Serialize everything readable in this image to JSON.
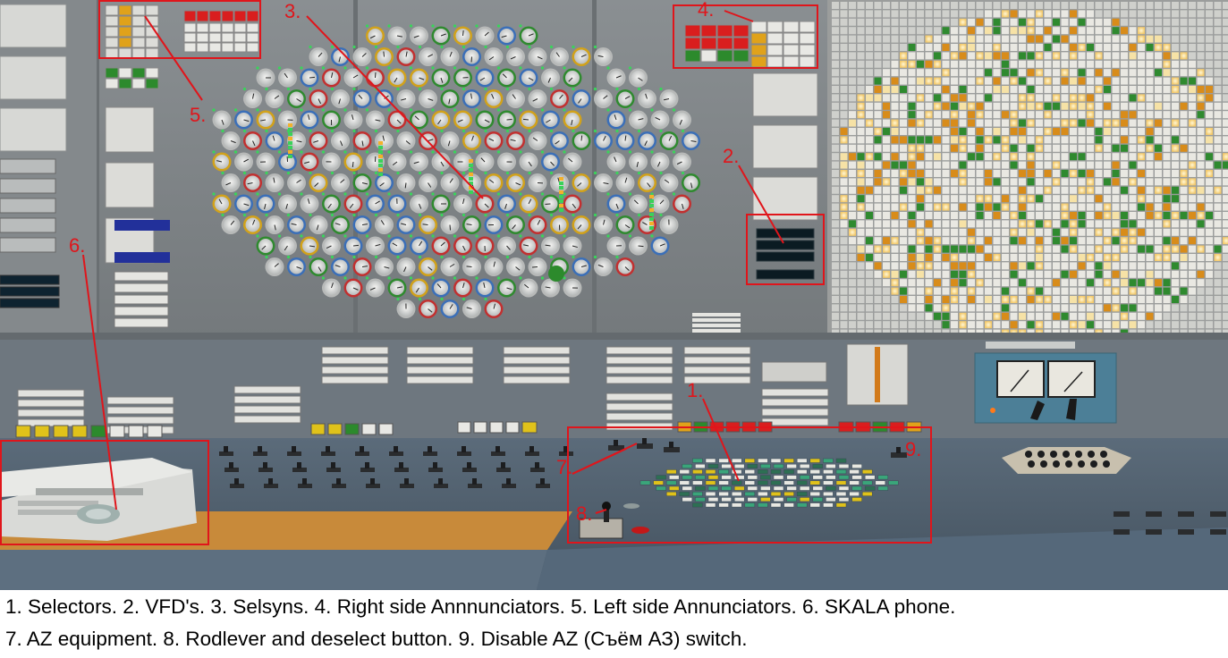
{
  "callouts": [
    {
      "number": "1."
    },
    {
      "number": "2."
    },
    {
      "number": "3."
    },
    {
      "number": "4."
    },
    {
      "number": "5."
    },
    {
      "number": "6."
    },
    {
      "number": "7."
    },
    {
      "number": "8."
    },
    {
      "number": "9."
    }
  ],
  "caption": {
    "line1": "1. Selectors. 2. VFD's. 3. Selsyns. 4. Right side Annnunciators. 5. Left side Annunciators. 6. SKALA phone.",
    "line2": "7. AZ equipment. 8. Rodlever and deselect button. 9. Disable AZ (Съём АЗ) switch."
  },
  "colors": {
    "callout": "#e0151b",
    "panel": "#7d8386",
    "desk": "#4e5d6b",
    "wood": "#c88a3a",
    "cartogram_glow": "#ffe6a0",
    "indicator_green": "#2c8a2c",
    "indicator_orange": "#d88c1a"
  },
  "icons": {
    "selsyn": "round-dial-gauge",
    "lamp": "square-indicator-lamp",
    "switch": "key-switch",
    "phone": "desk-phone",
    "meter": "analog-meter"
  }
}
